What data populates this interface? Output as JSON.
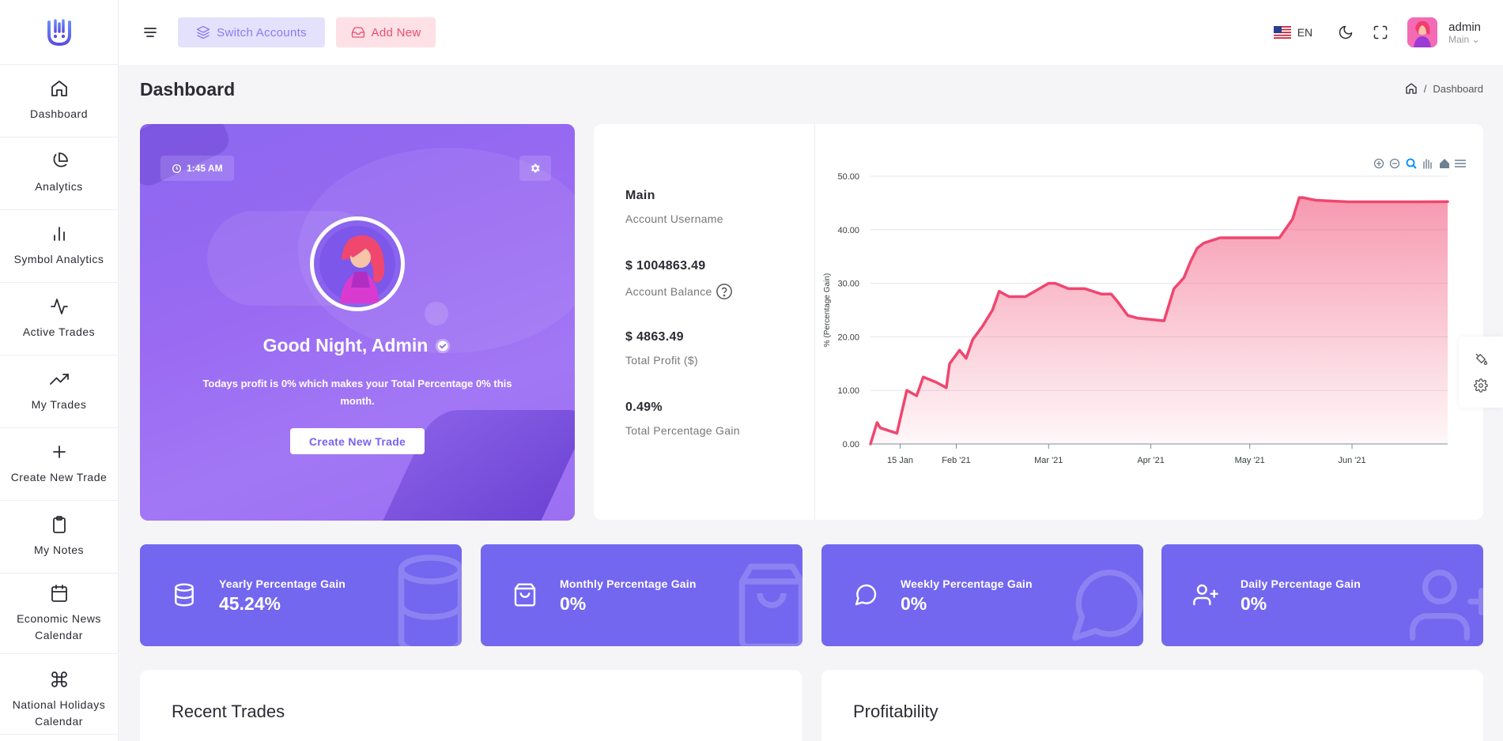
{
  "sidebar": {
    "items": [
      {
        "label": "Dashboard",
        "icon": "home-icon"
      },
      {
        "label": "Analytics",
        "icon": "pie-chart-icon"
      },
      {
        "label": "Symbol Analytics",
        "icon": "bar-chart-icon"
      },
      {
        "label": "Active Trades",
        "icon": "activity-icon"
      },
      {
        "label": "My Trades",
        "icon": "trending-up-icon"
      },
      {
        "label": "Create New Trade",
        "icon": "plus-icon"
      },
      {
        "label": "My Notes",
        "icon": "clipboard-icon"
      },
      {
        "label": "Economic News Calendar",
        "icon": "calendar-icon"
      },
      {
        "label": "National Holidays Calendar",
        "icon": "command-icon"
      }
    ]
  },
  "header": {
    "switch_accounts": "Switch Accounts",
    "add_new": "Add New",
    "language": "EN",
    "user_name": "admin",
    "user_account": "Main"
  },
  "page": {
    "title": "Dashboard",
    "breadcrumb": "Dashboard"
  },
  "welcome": {
    "time": "1:45 AM",
    "greeting": "Good Night, Admin",
    "message": "Todays profit is 0% which makes your Total Percentage 0% this month.",
    "button": "Create New Trade"
  },
  "stats": [
    {
      "value": "Main",
      "label": "Account Username"
    },
    {
      "value": "$ 1004863.49",
      "label": "Account Balance"
    },
    {
      "value": "$ 4863.49",
      "label": "Total Profit ($)"
    },
    {
      "value": "0.49%",
      "label": "Total Percentage Gain"
    }
  ],
  "summary": [
    {
      "title": "Yearly Percentage Gain",
      "value": "45.24%",
      "icon": "database-icon"
    },
    {
      "title": "Monthly Percentage Gain",
      "value": "0%",
      "icon": "shopping-bag-icon"
    },
    {
      "title": "Weekly Percentage Gain",
      "value": "0%",
      "icon": "message-circle-icon"
    },
    {
      "title": "Daily Percentage Gain",
      "value": "0%",
      "icon": "user-plus-icon"
    }
  ],
  "bottom": {
    "recent_trades": "Recent Trades",
    "profitability": "Profitability"
  },
  "colors": {
    "accent": "#7367f0",
    "line": "#f0466f",
    "welcome_start": "#8b67f0"
  },
  "chart_data": {
    "type": "area",
    "ylabel": "% (Percentage Gain)",
    "xlabel": "",
    "ylim": [
      0,
      50
    ],
    "yticks": [
      "0.00",
      "10.00",
      "20.00",
      "30.00",
      "40.00",
      "50.00"
    ],
    "xticks": [
      "15 Jan",
      "Feb '21",
      "Mar '21",
      "Apr '21",
      "May '21",
      "Jun '21"
    ],
    "grid": true,
    "toolbar": [
      "zoom-in-icon",
      "zoom-out-icon",
      "zoom-select-icon",
      "pan-icon",
      "reset-home-icon",
      "menu-icon"
    ],
    "x": [
      "2021-01-06",
      "2021-01-08",
      "2021-01-09",
      "2021-01-14",
      "2021-01-17",
      "2021-01-20",
      "2021-01-22",
      "2021-01-26",
      "2021-01-29",
      "2021-01-30",
      "2021-02-02",
      "2021-02-04",
      "2021-02-06",
      "2021-02-09",
      "2021-02-12",
      "2021-02-14",
      "2021-02-17",
      "2021-02-18",
      "2021-02-22",
      "2021-03-01",
      "2021-03-03",
      "2021-03-07",
      "2021-03-12",
      "2021-03-17",
      "2021-03-20",
      "2021-03-22",
      "2021-03-25",
      "2021-03-28",
      "2021-04-05",
      "2021-04-08",
      "2021-04-11",
      "2021-04-13",
      "2021-04-15",
      "2021-04-17",
      "2021-04-22",
      "2021-04-29",
      "2021-05-10",
      "2021-05-14",
      "2021-05-16",
      "2021-05-17",
      "2021-05-21",
      "2021-05-31",
      "2021-06-10",
      "2021-06-20",
      "2021-06-30"
    ],
    "values": [
      0,
      4,
      3,
      2,
      10,
      9,
      12.5,
      11.5,
      10.5,
      15,
      17.5,
      16,
      19.5,
      22,
      25,
      28.5,
      27.5,
      27.5,
      27.5,
      30,
      30,
      29,
      29,
      28,
      28,
      26.5,
      24,
      23.5,
      23,
      29,
      31,
      34,
      36.5,
      37.5,
      38.5,
      38.5,
      38.5,
      42,
      46,
      46,
      45.5,
      45.2,
      45.2,
      45.2,
      45.24
    ]
  }
}
